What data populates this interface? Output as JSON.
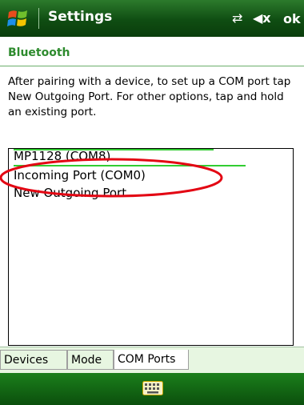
{
  "titlebar": {
    "title": "Settings",
    "ok_label": "ok",
    "status_icons": [
      "connectivity-icon",
      "volume-muted-icon"
    ]
  },
  "subheader": {
    "text": "Bluetooth"
  },
  "instructions": {
    "text": "After pairing with a device, to set up a COM port tap New Outgoing Port. For other options, tap and hold an existing port."
  },
  "com_ports": {
    "items": [
      "MP1128 (COM8)",
      "Incoming Port (COM0)",
      "New Outgoing Port"
    ]
  },
  "tabs": [
    {
      "label": "Devices"
    },
    {
      "label": "Mode"
    },
    {
      "label": "COM Ports",
      "selected": true
    }
  ],
  "bottombar": {
    "icon": "keyboard-icon"
  },
  "colors": {
    "title_bg": "#0f4d12",
    "accent_green": "#2e8b2e",
    "highlight_red": "#e30613",
    "tab_bg": "#e7f6e1"
  }
}
